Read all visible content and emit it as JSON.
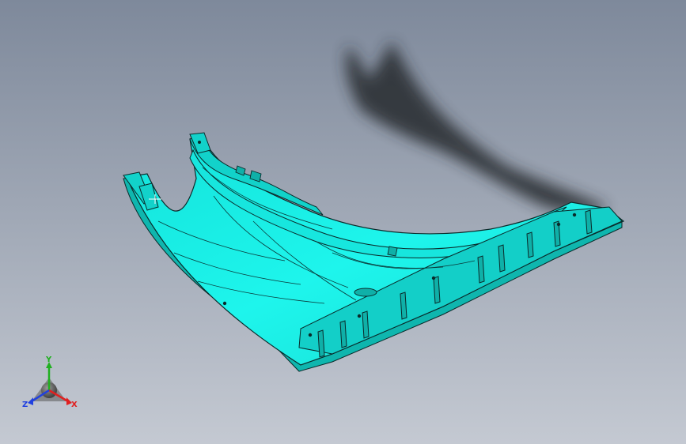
{
  "viewport": {
    "background_top": "#7f8a9c",
    "background_bottom": "#c3c8d1",
    "part_color": "#19f0e6",
    "part_dark": "#10b8b0",
    "edge_color": "#0a2a2a",
    "shadow_color": "#2a2d32"
  },
  "triad": {
    "x_label": "X",
    "y_label": "Y",
    "z_label": "Z",
    "x_color": "#e02020",
    "y_color": "#20b020",
    "z_color": "#2040e0"
  }
}
